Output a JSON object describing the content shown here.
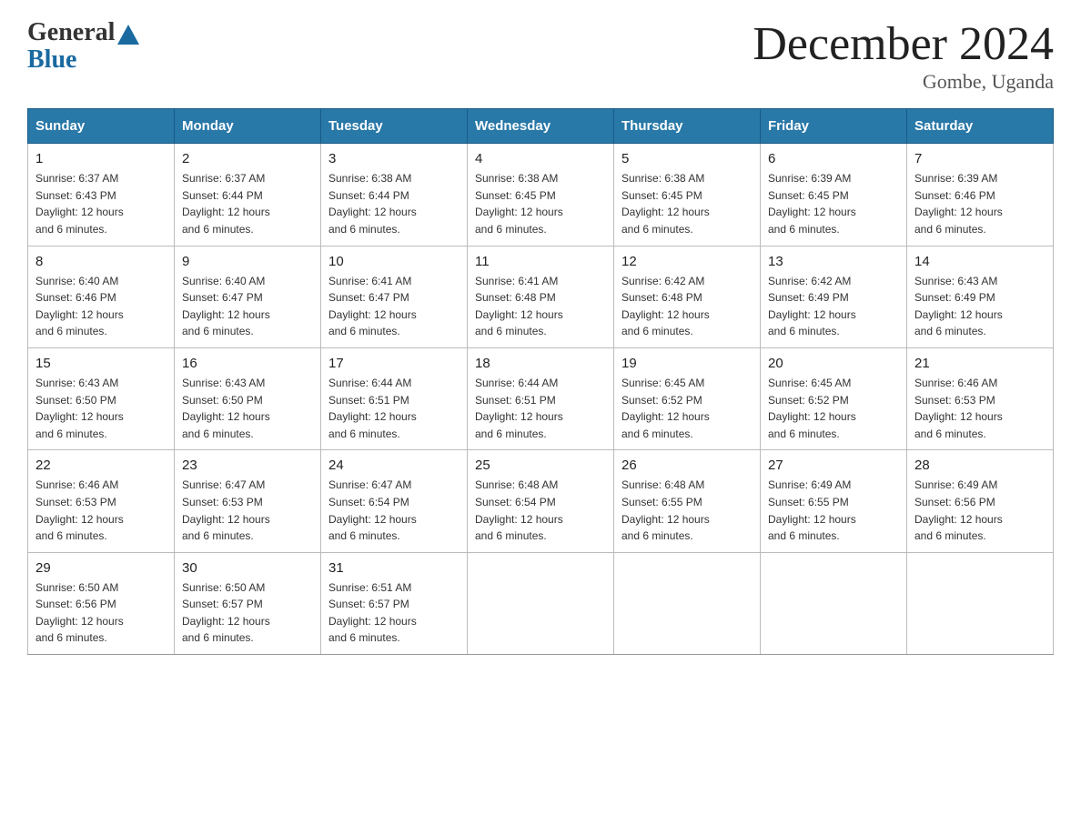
{
  "logo": {
    "text_general": "General",
    "text_blue": "Blue"
  },
  "header": {
    "month_year": "December 2024",
    "location": "Gombe, Uganda"
  },
  "days_of_week": [
    "Sunday",
    "Monday",
    "Tuesday",
    "Wednesday",
    "Thursday",
    "Friday",
    "Saturday"
  ],
  "weeks": [
    [
      {
        "day": "1",
        "sunrise": "6:37 AM",
        "sunset": "6:43 PM",
        "daylight": "12 hours and 6 minutes."
      },
      {
        "day": "2",
        "sunrise": "6:37 AM",
        "sunset": "6:44 PM",
        "daylight": "12 hours and 6 minutes."
      },
      {
        "day": "3",
        "sunrise": "6:38 AM",
        "sunset": "6:44 PM",
        "daylight": "12 hours and 6 minutes."
      },
      {
        "day": "4",
        "sunrise": "6:38 AM",
        "sunset": "6:45 PM",
        "daylight": "12 hours and 6 minutes."
      },
      {
        "day": "5",
        "sunrise": "6:38 AM",
        "sunset": "6:45 PM",
        "daylight": "12 hours and 6 minutes."
      },
      {
        "day": "6",
        "sunrise": "6:39 AM",
        "sunset": "6:45 PM",
        "daylight": "12 hours and 6 minutes."
      },
      {
        "day": "7",
        "sunrise": "6:39 AM",
        "sunset": "6:46 PM",
        "daylight": "12 hours and 6 minutes."
      }
    ],
    [
      {
        "day": "8",
        "sunrise": "6:40 AM",
        "sunset": "6:46 PM",
        "daylight": "12 hours and 6 minutes."
      },
      {
        "day": "9",
        "sunrise": "6:40 AM",
        "sunset": "6:47 PM",
        "daylight": "12 hours and 6 minutes."
      },
      {
        "day": "10",
        "sunrise": "6:41 AM",
        "sunset": "6:47 PM",
        "daylight": "12 hours and 6 minutes."
      },
      {
        "day": "11",
        "sunrise": "6:41 AM",
        "sunset": "6:48 PM",
        "daylight": "12 hours and 6 minutes."
      },
      {
        "day": "12",
        "sunrise": "6:42 AM",
        "sunset": "6:48 PM",
        "daylight": "12 hours and 6 minutes."
      },
      {
        "day": "13",
        "sunrise": "6:42 AM",
        "sunset": "6:49 PM",
        "daylight": "12 hours and 6 minutes."
      },
      {
        "day": "14",
        "sunrise": "6:43 AM",
        "sunset": "6:49 PM",
        "daylight": "12 hours and 6 minutes."
      }
    ],
    [
      {
        "day": "15",
        "sunrise": "6:43 AM",
        "sunset": "6:50 PM",
        "daylight": "12 hours and 6 minutes."
      },
      {
        "day": "16",
        "sunrise": "6:43 AM",
        "sunset": "6:50 PM",
        "daylight": "12 hours and 6 minutes."
      },
      {
        "day": "17",
        "sunrise": "6:44 AM",
        "sunset": "6:51 PM",
        "daylight": "12 hours and 6 minutes."
      },
      {
        "day": "18",
        "sunrise": "6:44 AM",
        "sunset": "6:51 PM",
        "daylight": "12 hours and 6 minutes."
      },
      {
        "day": "19",
        "sunrise": "6:45 AM",
        "sunset": "6:52 PM",
        "daylight": "12 hours and 6 minutes."
      },
      {
        "day": "20",
        "sunrise": "6:45 AM",
        "sunset": "6:52 PM",
        "daylight": "12 hours and 6 minutes."
      },
      {
        "day": "21",
        "sunrise": "6:46 AM",
        "sunset": "6:53 PM",
        "daylight": "12 hours and 6 minutes."
      }
    ],
    [
      {
        "day": "22",
        "sunrise": "6:46 AM",
        "sunset": "6:53 PM",
        "daylight": "12 hours and 6 minutes."
      },
      {
        "day": "23",
        "sunrise": "6:47 AM",
        "sunset": "6:53 PM",
        "daylight": "12 hours and 6 minutes."
      },
      {
        "day": "24",
        "sunrise": "6:47 AM",
        "sunset": "6:54 PM",
        "daylight": "12 hours and 6 minutes."
      },
      {
        "day": "25",
        "sunrise": "6:48 AM",
        "sunset": "6:54 PM",
        "daylight": "12 hours and 6 minutes."
      },
      {
        "day": "26",
        "sunrise": "6:48 AM",
        "sunset": "6:55 PM",
        "daylight": "12 hours and 6 minutes."
      },
      {
        "day": "27",
        "sunrise": "6:49 AM",
        "sunset": "6:55 PM",
        "daylight": "12 hours and 6 minutes."
      },
      {
        "day": "28",
        "sunrise": "6:49 AM",
        "sunset": "6:56 PM",
        "daylight": "12 hours and 6 minutes."
      }
    ],
    [
      {
        "day": "29",
        "sunrise": "6:50 AM",
        "sunset": "6:56 PM",
        "daylight": "12 hours and 6 minutes."
      },
      {
        "day": "30",
        "sunrise": "6:50 AM",
        "sunset": "6:57 PM",
        "daylight": "12 hours and 6 minutes."
      },
      {
        "day": "31",
        "sunrise": "6:51 AM",
        "sunset": "6:57 PM",
        "daylight": "12 hours and 6 minutes."
      },
      null,
      null,
      null,
      null
    ]
  ],
  "labels": {
    "sunrise": "Sunrise:",
    "sunset": "Sunset:",
    "daylight": "Daylight:"
  }
}
